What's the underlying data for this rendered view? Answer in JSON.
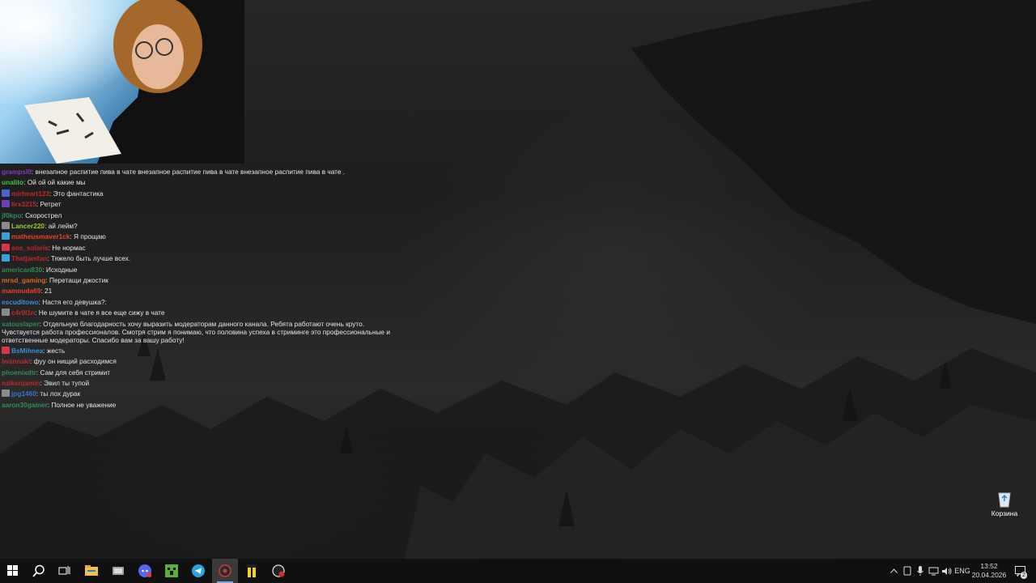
{
  "chat": {
    "messages": [
      {
        "user": "grampsl0",
        "text": "внезапное распитие пива в чате внезапное распитие пива в чате внезапное распитие пива в чате .",
        "color": "#7a3fc4",
        "badge": null
      },
      {
        "user": "unalito",
        "text": "Ой ой ой какие мы",
        "color": "#3ec43e",
        "badge": null
      },
      {
        "user": "mirheart123",
        "text": "Это фантастика",
        "color": "#c0282b",
        "badge": "#4a63c8"
      },
      {
        "user": "lirx3215",
        "text": "Ретрет",
        "color": "#c0282b",
        "badge": "#6a3fb8"
      },
      {
        "user": "jf0kpo",
        "text": "Скорострел",
        "color": "#2e8b57",
        "badge": null
      },
      {
        "user": "Lancer220",
        "text": "ай лейм?",
        "color": "#9acd32",
        "badge": "#8a8a8a"
      },
      {
        "user": "matheusmaver1ck",
        "text": "Я прощаю",
        "color": "#e8402a",
        "badge": "#3aa0d8"
      },
      {
        "user": "sos_solaris",
        "text": "Не нормас",
        "color": "#c0282b",
        "badge": "#d8344a"
      },
      {
        "user": "Thatjamfan",
        "text": "Тяжело быть лучше всех.",
        "color": "#c0282b",
        "badge": "#3aa0d8"
      },
      {
        "user": "american830",
        "text": "Исходные",
        "color": "#2e8b57",
        "badge": null
      },
      {
        "user": "mrsd_gaming",
        "text": "Перетащи джостик",
        "color": "#d2691e",
        "badge": null
      },
      {
        "user": "mamouda69",
        "text": "21",
        "color": "#e8402a",
        "badge": null
      },
      {
        "user": "escuditowo",
        "text": "Настя его девушка?:",
        "color": "#3a8fd8",
        "badge": null
      },
      {
        "user": "c4r0l1n",
        "text": "Не шумите в чате я все еще сижу в чате",
        "color": "#c0282b",
        "badge": "#8a8a8a"
      },
      {
        "user": "satouslaper",
        "text": "Отдельную благодарность хочу выразить модераторам данного канала. Ребята работают очень круто. Чувствуется работа профессионалов. Смотря стрим я понимаю, что половина успеха в стриминге это профессиональные и ответственные модераторы. Спасибо вам за вашу работу!",
        "color": "#2e8b57",
        "badge": null
      },
      {
        "user": "BsMihnea",
        "text": "жесть",
        "color": "#3a8fd8",
        "badge": "#d8344a"
      },
      {
        "user": "lwannaki",
        "text": "фуу он нищий расходимся",
        "color": "#c0282b",
        "badge": null
      },
      {
        "user": "phoenixdtr",
        "text": "Сам для себя стримит",
        "color": "#2e8b57",
        "badge": null
      },
      {
        "user": "nzikenjamin",
        "text": "Эвил ты тупой",
        "color": "#c0282b",
        "badge": null
      },
      {
        "user": "jpg1460",
        "text": "ты лох дурак",
        "color": "#3a6fd8",
        "badge": "#8a8a8a"
      },
      {
        "user": "aaron30gamer",
        "text": "Полное не уважение",
        "color": "#2e8b57",
        "badge": null
      }
    ]
  },
  "desktop": {
    "recycle_bin_label": "Корзина"
  },
  "taskbar": {
    "apps": [
      {
        "icon": "start-icon"
      },
      {
        "icon": "search-icon"
      },
      {
        "icon": "task-view-icon"
      },
      {
        "icon": "file-explorer-icon"
      },
      {
        "icon": "app-icon"
      },
      {
        "icon": "discord-icon"
      },
      {
        "icon": "minecraft-icon"
      },
      {
        "icon": "telegram-icon"
      },
      {
        "icon": "obs-icon"
      },
      {
        "icon": "app-yellow-icon"
      },
      {
        "icon": "app-red-icon"
      }
    ],
    "tray": {
      "language": "ENG",
      "time": "13:52",
      "date": "20.04.2026",
      "notifications_count": "2"
    }
  }
}
